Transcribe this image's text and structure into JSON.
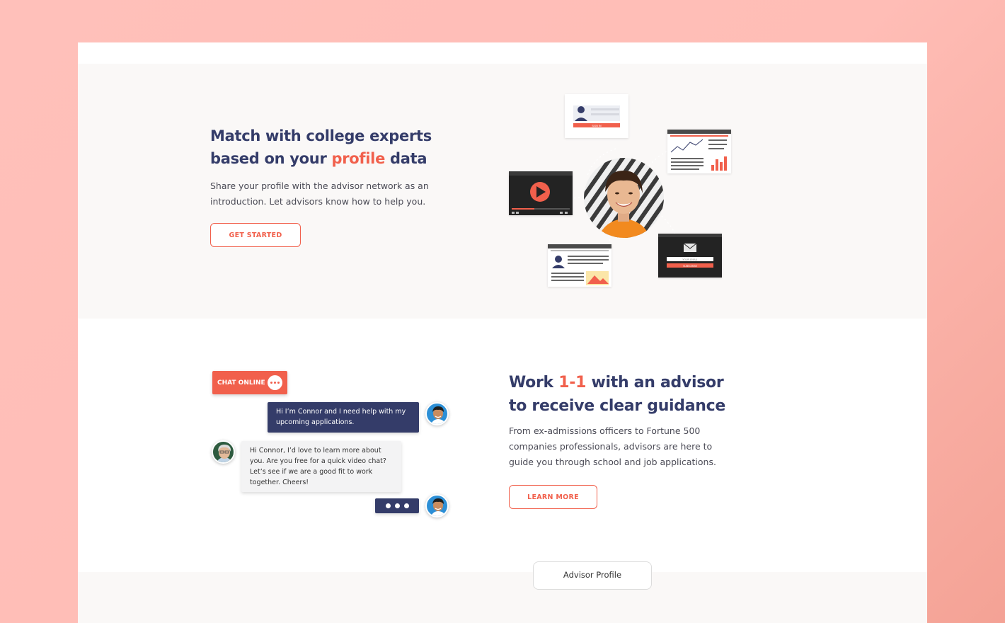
{
  "section_profile": {
    "title_part1": "Match with college experts based on your ",
    "title_highlight": "profile",
    "title_part2": " data",
    "description": "Share your profile with the advisor network as an introduction. Let advisors know how to help you.",
    "cta_label": "GET STARTED",
    "illustration": {
      "login_button_label": "SIGN IN",
      "email_placeholder": "YOUR EMAIL",
      "subscribe_label": "SUBSCRIBE"
    }
  },
  "section_advisor": {
    "badge_label": "CHAT ONLINE",
    "user_message": "Hi I’m Connor and I need help with my upcoming applications.",
    "advisor_message": "Hi Connor, I’d love to learn more about you. Are you free for a quick video chat? Let’s see if we are a good fit to work together. Cheers!",
    "title_part1": "Work ",
    "title_highlight": "1-1",
    "title_part2": " with an advisor to receive clear guidance",
    "description": "From ex-admissions officers to Fortune 500 companies professionals, advisors are here to guide you through school and job applications.",
    "cta_label": "LEARN MORE"
  },
  "section_next": {
    "tab_label": "Advisor Profile"
  },
  "colors": {
    "navy": "#343c69",
    "coral": "#f1604c",
    "background": "#ffbdb6"
  }
}
